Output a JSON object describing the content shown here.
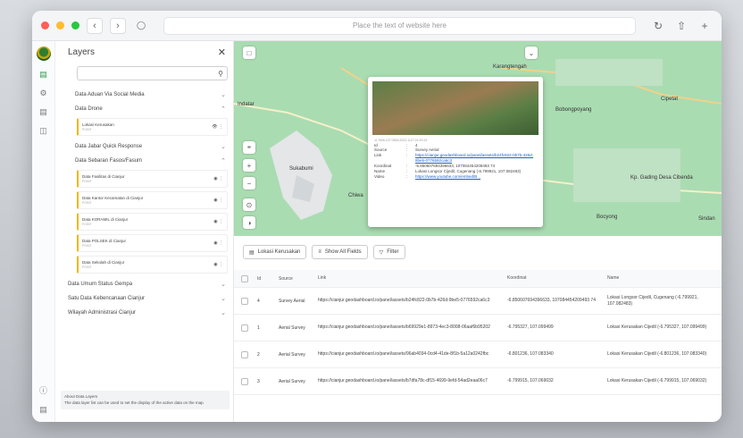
{
  "browser": {
    "address_placeholder": "Place the text of website here"
  },
  "sidebar": {
    "title": "Layers",
    "search_placeholder": "",
    "groups": [
      {
        "label": "Data Aduan Via Social Media"
      },
      {
        "label": "Data Drone"
      },
      {
        "label": "Data Jabar Quick Response"
      },
      {
        "label": "Data Sebaran Fasos/Fasum"
      },
      {
        "label": "Data Umum Status Gempa"
      },
      {
        "label": "Satu Data Kebencanaan Cianjur"
      },
      {
        "label": "Wilayah Administrasi Cianjur"
      }
    ],
    "drone_items": [
      {
        "label": "Lokasi Kerusakan",
        "type": "POINT"
      }
    ],
    "fasos_items": [
      {
        "label": "Data Fasilitas di Cianjur",
        "type": "POINT"
      },
      {
        "label": "Data Kantor Kecamatan di Cianjur",
        "type": "POINT"
      },
      {
        "label": "Data KORAMIL di Cianjur",
        "type": "POINT"
      },
      {
        "label": "Data POLSEK di Cianjur",
        "type": "POINT"
      },
      {
        "label": "Data Sekolah di Cianjur",
        "type": "POINT"
      }
    ],
    "about": {
      "title": "About Data Layers",
      "text": "The data layer list can be used to set the display of the active data on the map"
    }
  },
  "map": {
    "labels": {
      "karangtengah": "Karangtengah",
      "cipetat": "Cipetat",
      "bobongpoyang": "Bobongpoyang",
      "sukabumi": "Sukabumi",
      "chiwa": "Chiwa",
      "indatar": "Indatar",
      "kp_gading": "Kp. Gading Desa Cibenda",
      "bocyong": "Bocyong",
      "sindang": "Sindan"
    },
    "popup": {
      "coords_caption": "-6.7606,107.0826,2023,1127,01:20:19",
      "rows": [
        {
          "k": "Id",
          "v": "4"
        },
        {
          "k": "Source",
          "v": "Survey Aerial"
        },
        {
          "k": "Link",
          "v": "https://cianjur.geodashboard.io/panel/assets/b24fc822-0b7b-426d-9be5-0776592ca6c3",
          "link": true
        },
        {
          "k": "Koordinat",
          "v": "-6.850607694396633, 107084454209493 74"
        },
        {
          "k": "Name",
          "v": "Lokasi Longsor Cijedil, Cugenang (-6.799921, 107.082483)"
        },
        {
          "k": "Video",
          "v": "https://www.youtube.com/embed/B...",
          "link": true
        }
      ]
    }
  },
  "toolbar": {
    "layer_label": "Lokasi Kerusakan",
    "show_fields": "Show All Fields",
    "filter": "Filter"
  },
  "table": {
    "headers": {
      "id": "Id",
      "source": "Source",
      "link": "Link",
      "koordinat": "Koordinat",
      "name": "Name"
    },
    "rows": [
      {
        "id": "4",
        "source": "Survey Aerial",
        "link": "https://cianjur.geodashboard.io/panel/assets/b24fc822-0b7b-426d-9be5-0776592ca6c3",
        "koordinat": "-6.850607694396633, 107084454209493 74",
        "name": "Lokasi Longsor Cijedil, Cugenang (-6.799921, 107.082483)"
      },
      {
        "id": "1",
        "source": "Aerial Survey",
        "link": "https://cianjur.geodashboard.io/panel/assets/b69929e1-8973-4ec3-8008-06aaf6b95202",
        "koordinat": "-6.795327, 107.099499",
        "name": "Lokasi Kerusakan Cijedil (-6.795327, 107.099499)"
      },
      {
        "id": "2",
        "source": "Aerial Survey",
        "link": "https://cianjur.geodashboard.io/panel/assets/96ab4034-0cd4-41de-8f1b-5a12a0242fbc",
        "koordinat": "-6.801236, 107.083340",
        "name": "Lokasi Kerusakan Cijedil (-6.801236, 107.083340)"
      },
      {
        "id": "3",
        "source": "Aerial Survey",
        "link": "https://cianjur.geodashboard.io/panel/assets/b7dfa78c-df15-4699-9efd-54ad2eaa06c7",
        "koordinat": "-6.799915, 107.069032",
        "name": "Lokasi Kerusakan Cijedil (-6.799915, 107.069032)"
      }
    ]
  },
  "colors": {
    "accent": "#f2b705",
    "map_green": "#aadcb2",
    "link": "#1a5fd0"
  }
}
